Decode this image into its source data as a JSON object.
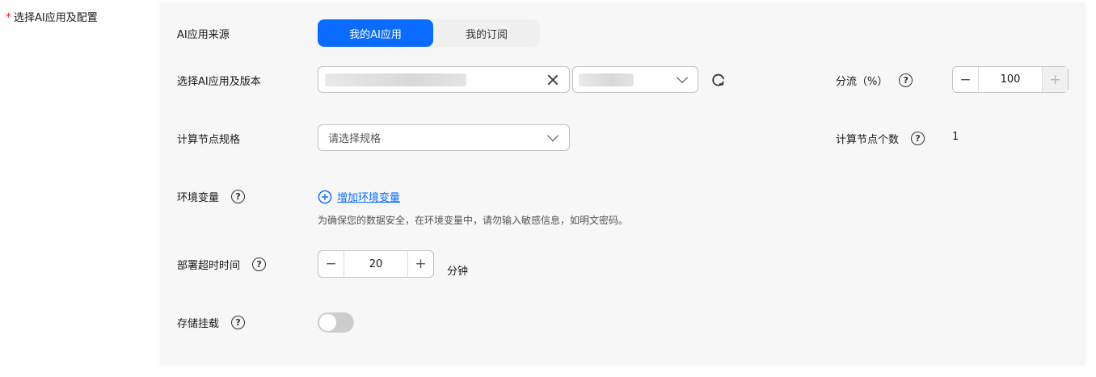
{
  "section": {
    "required_mark": "*",
    "label": "选择AI应用及配置"
  },
  "source": {
    "label": "AI应用来源",
    "tabs": [
      {
        "label": "我的AI应用",
        "active": true
      },
      {
        "label": "我的订阅",
        "active": false
      }
    ]
  },
  "app_select": {
    "label": "选择AI应用及版本",
    "refresh_icon": "refresh-icon",
    "clear_icon": "close-icon"
  },
  "traffic": {
    "label": "分流（%）",
    "help": "?",
    "minus": "−",
    "value": "100",
    "plus": "+"
  },
  "spec": {
    "label": "计算节点规格",
    "placeholder": "请选择规格"
  },
  "node_count": {
    "label": "计算节点个数",
    "help": "?",
    "value": "1"
  },
  "env": {
    "label": "环境变量",
    "help": "?",
    "add_label": "增加环境变量",
    "add_icon": "plus-circle-icon",
    "hint": "为确保您的数据安全，在环境变量中，请勿输入敏感信息，如明文密码。"
  },
  "timeout": {
    "label": "部署超时时间",
    "help": "?",
    "minus": "−",
    "value": "20",
    "plus": "+",
    "unit": "分钟"
  },
  "storage": {
    "label": "存储挂载",
    "help": "?",
    "enabled": false
  },
  "colors": {
    "primary": "#0c6bff",
    "required": "#e0242c",
    "panel_bg": "#f7f7f7"
  }
}
